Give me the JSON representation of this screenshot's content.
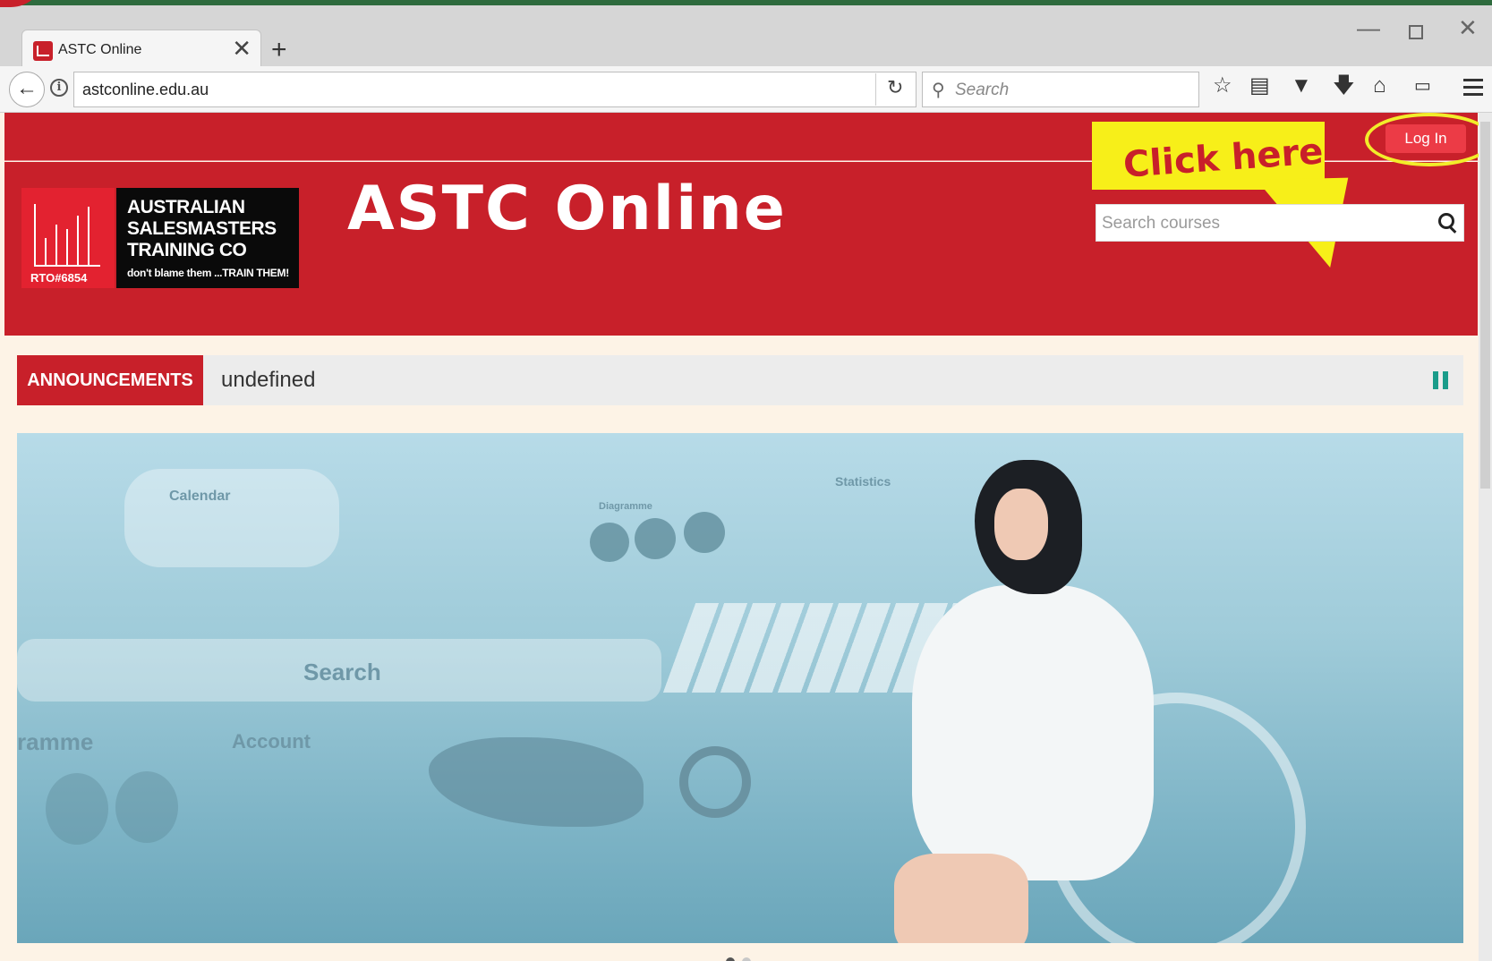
{
  "browser": {
    "tab_title": "ASTC Online",
    "tab_close_glyph": "✕",
    "new_tab_glyph": "+",
    "url": "astconline.edu.au",
    "search_placeholder": "Search",
    "window_minimize": "—",
    "window_close": "✕",
    "toolbar_icons": [
      "star-icon",
      "reading-list-icon",
      "pocket-icon",
      "download-icon",
      "home-icon",
      "screenshot-icon",
      "menu-icon"
    ]
  },
  "site": {
    "title": "ASTC Online",
    "login_label": "Log In",
    "logo": {
      "line1": "AUSTRALIAN",
      "line2": "SALESMASTERS",
      "line3": "TRAINING CO",
      "tagline": "don't blame them ...TRAIN THEM!",
      "rto": "RTO#6854"
    },
    "course_search_placeholder": "Search courses",
    "announcements_label": "ANNOUNCEMENTS",
    "announcement_text": "undefined",
    "slider_labels": {
      "calendar": "Calendar",
      "search": "Search",
      "programme": "ramme",
      "account": "Account",
      "statistics": "Statistics",
      "diagramme": "Diagramme"
    }
  },
  "annotation": {
    "callout_text": "Click here"
  },
  "colors": {
    "brand_red": "#c8202a",
    "login_red": "#ec3b46",
    "highlight_yellow": "#f7ef19",
    "pause_teal": "#1a9c8a"
  }
}
